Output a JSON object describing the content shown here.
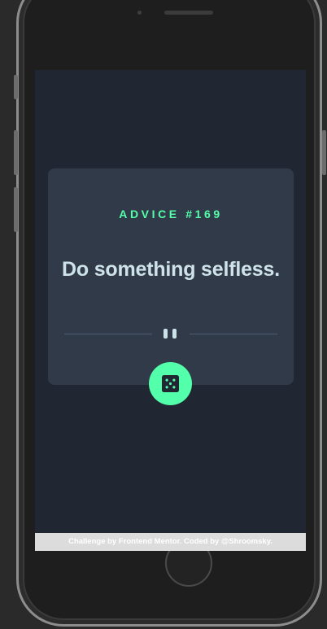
{
  "advice": {
    "id_label": "ADVICE #169",
    "text": "Do something selfless."
  },
  "actions": {
    "generate_icon": "dice-icon"
  },
  "footer": {
    "credit": "Challenge by Frontend Mentor. Coded by @Shroomsky."
  },
  "colors": {
    "accent": "#53ffaa",
    "card": "#313a48",
    "screen_bg": "#202733",
    "text_light": "#cee3e9",
    "divider": "#4f5d74"
  }
}
